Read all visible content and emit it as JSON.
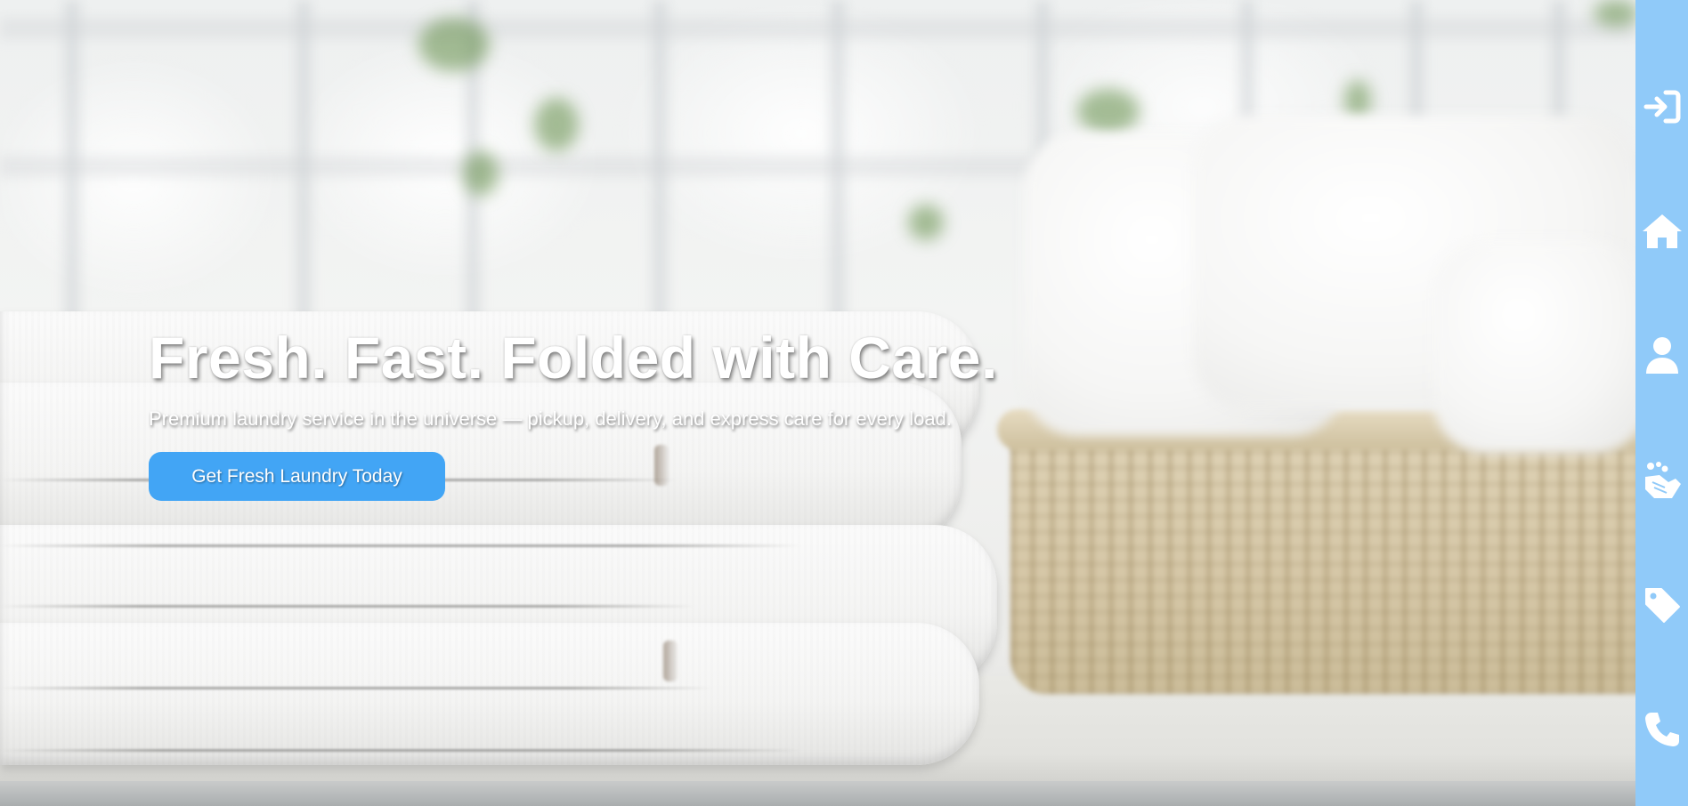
{
  "hero": {
    "title": "Fresh. Fast. Folded with Care.",
    "subtitle": "Premium laundry service in the universe — pickup, delivery, and express care for every load.",
    "cta_label": "Get Fresh Laundry Today"
  },
  "sidebar": {
    "items": [
      {
        "icon": "sign-in-icon"
      },
      {
        "icon": "home-icon"
      },
      {
        "icon": "user-icon"
      },
      {
        "icon": "hands-wash-icon"
      },
      {
        "icon": "tag-icon"
      },
      {
        "icon": "phone-icon"
      }
    ]
  },
  "colors": {
    "accent": "#42a5f5",
    "sidebar": "#90caf9",
    "text": "#ffffff"
  }
}
